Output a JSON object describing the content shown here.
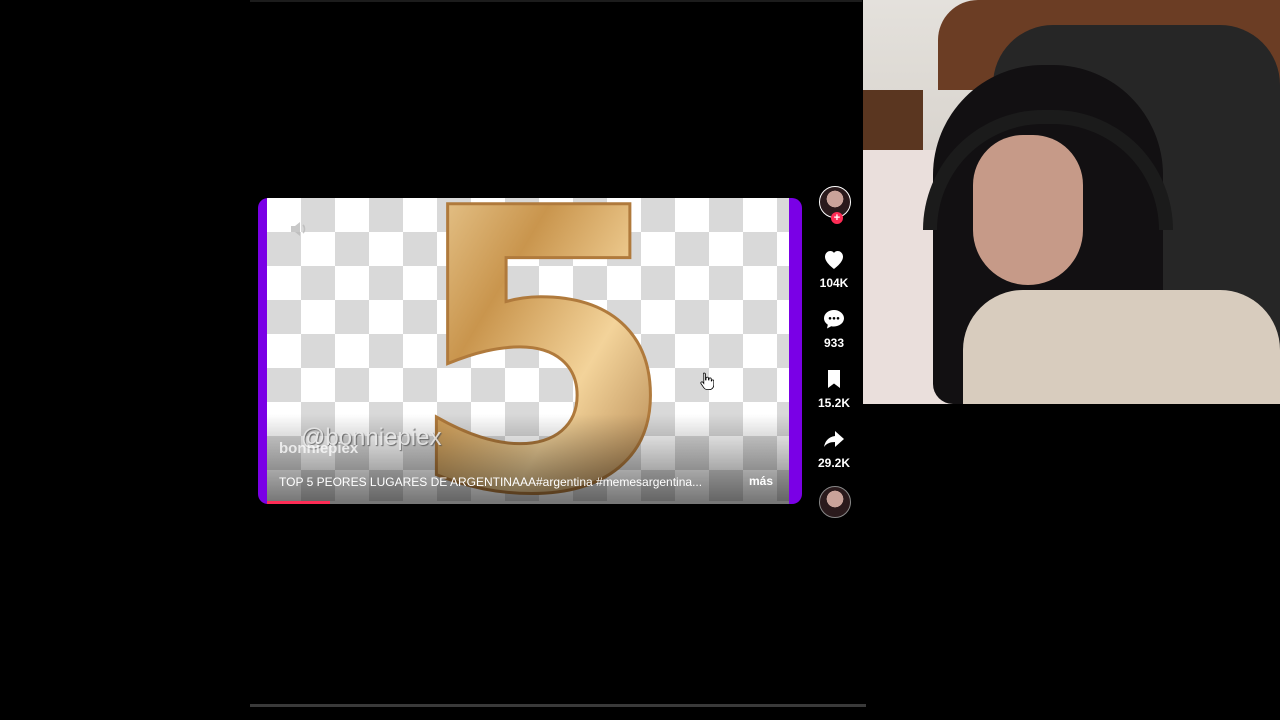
{
  "video": {
    "watermark": "@bonniepiex",
    "username": "bonniepiex",
    "caption": "TOP 5 PEORES LUGARES DE ARGENTINAAA#argentina #memesargentina...",
    "more_label": "más",
    "big_number": "5",
    "progress": 0.12
  },
  "actions": {
    "likes": "104K",
    "comments": "933",
    "saves": "15.2K",
    "shares": "29.2K"
  },
  "colors": {
    "accent": "#fe2c55",
    "frame": "#7a00e6"
  }
}
